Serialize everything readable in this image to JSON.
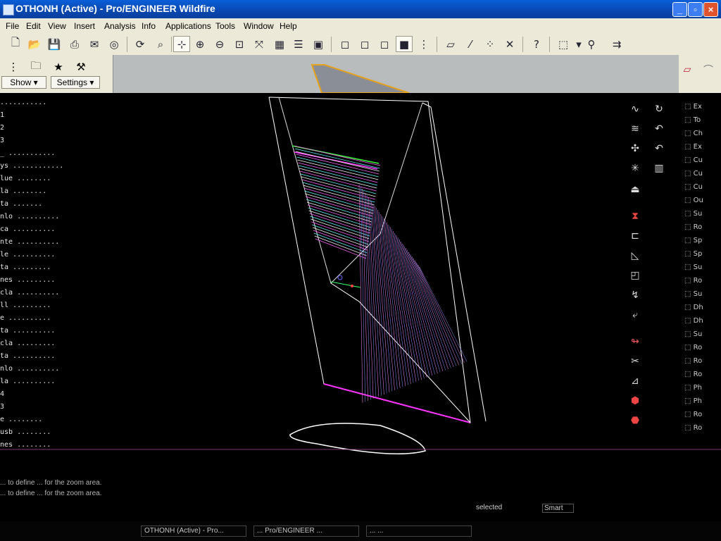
{
  "window": {
    "title": "OTHONH (Active) - Pro/ENGINEER Wildfire"
  },
  "menu": [
    "File",
    "Edit",
    "View",
    "Insert",
    "Analysis",
    "Info",
    "Applications",
    "Tools",
    "Window",
    "Help"
  ],
  "toolbar_icons": [
    "new-icon",
    "open-icon",
    "save-icon",
    "print-icon",
    "email-icon",
    "disabled-icon",
    "regenerate-icon",
    "find-icon",
    "spin-center-icon",
    "zoom-in-icon",
    "zoom-out-icon",
    "refit-icon",
    "reorient-icon",
    "saved-views-icon",
    "layers-icon",
    "setup-icon",
    "wireframe-icon",
    "hidden-line-icon",
    "no-hidden-icon",
    "shading-icon",
    "datum-display-icon",
    "datum-planes-icon",
    "datum-axes-icon",
    "datum-points-icon",
    "csys-icon",
    "whats-this-icon",
    "selection-box-icon",
    "filter-icon",
    "binoculars-icon",
    "next-icon"
  ],
  "left_panel": {
    "show": "Show",
    "settings": "Settings"
  },
  "model_tree": [
    "...........",
    "1",
    "2",
    "3",
    "_ ...........",
    "ys ............",
    "lue ........",
    "la ........",
    "ta .......",
    "nlo ..........",
    "ca ..........",
    "nte ..........",
    "le ..........",
    "ta .........",
    "nes .........",
    "cla ..........",
    "ll .........",
    "e ..........",
    "ta ..........",
    "cla .........",
    "ta ..........",
    "nlo ..........",
    "la ..........",
    "4",
    "3",
    "e ........",
    "usb ........",
    "nes ........"
  ],
  "right_tools": [
    "sketch-icon",
    "curve-icon",
    "surface-icon",
    "pattern-icon",
    "extrude-icon",
    "revolve-icon",
    "sweep-icon",
    "blend-icon",
    "round-icon",
    "chamfer-icon",
    "draft-icon",
    "shell-icon",
    "rib-icon",
    "trim-icon",
    "merge-icon",
    "offset-icon",
    "thicken-icon",
    "solidify-icon"
  ],
  "far_right_items": [
    "Ex",
    "To",
    "Ch",
    "Ex",
    "Cu",
    "Cu",
    "Cu",
    "Ou",
    "Su",
    "Ro",
    "Sp",
    "Sp",
    "Su",
    "Ro",
    "Su",
    "Dh",
    "Dh",
    "Su",
    "Ro",
    "Ro",
    "Ro",
    "Ph",
    "Ph",
    "Ro",
    "Ro"
  ],
  "messages": [
    "... to define ... for the zoom area.",
    "... to define ... for the zoom area."
  ],
  "status": {
    "selected": "selected",
    "filter": "Smart"
  },
  "taskbar": [
    "OTHONH (Active) - Pro...",
    "... Pro/ENGINEER ...",
    "... ..."
  ]
}
